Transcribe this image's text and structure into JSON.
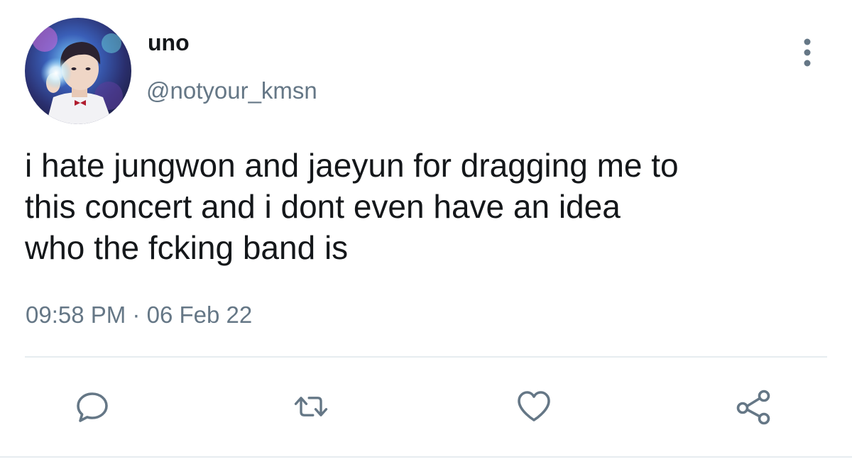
{
  "user": {
    "display_name": "uno",
    "handle": "@notyour_kmsn"
  },
  "tweet": {
    "text": "i hate jungwon and jaeyun for dragging me to\nthis concert and i dont even have an idea\nwho the fcking band is",
    "time": "09:58 PM",
    "separator": "·",
    "date": "06 Feb 22"
  },
  "icons": {
    "more": "more-vertical-icon",
    "reply": "comment-icon",
    "retweet": "retweet-icon",
    "like": "heart-icon",
    "share": "share-icon"
  },
  "colors": {
    "text": "#14171a",
    "secondary": "#657786",
    "divider": "#e6ecf0"
  }
}
